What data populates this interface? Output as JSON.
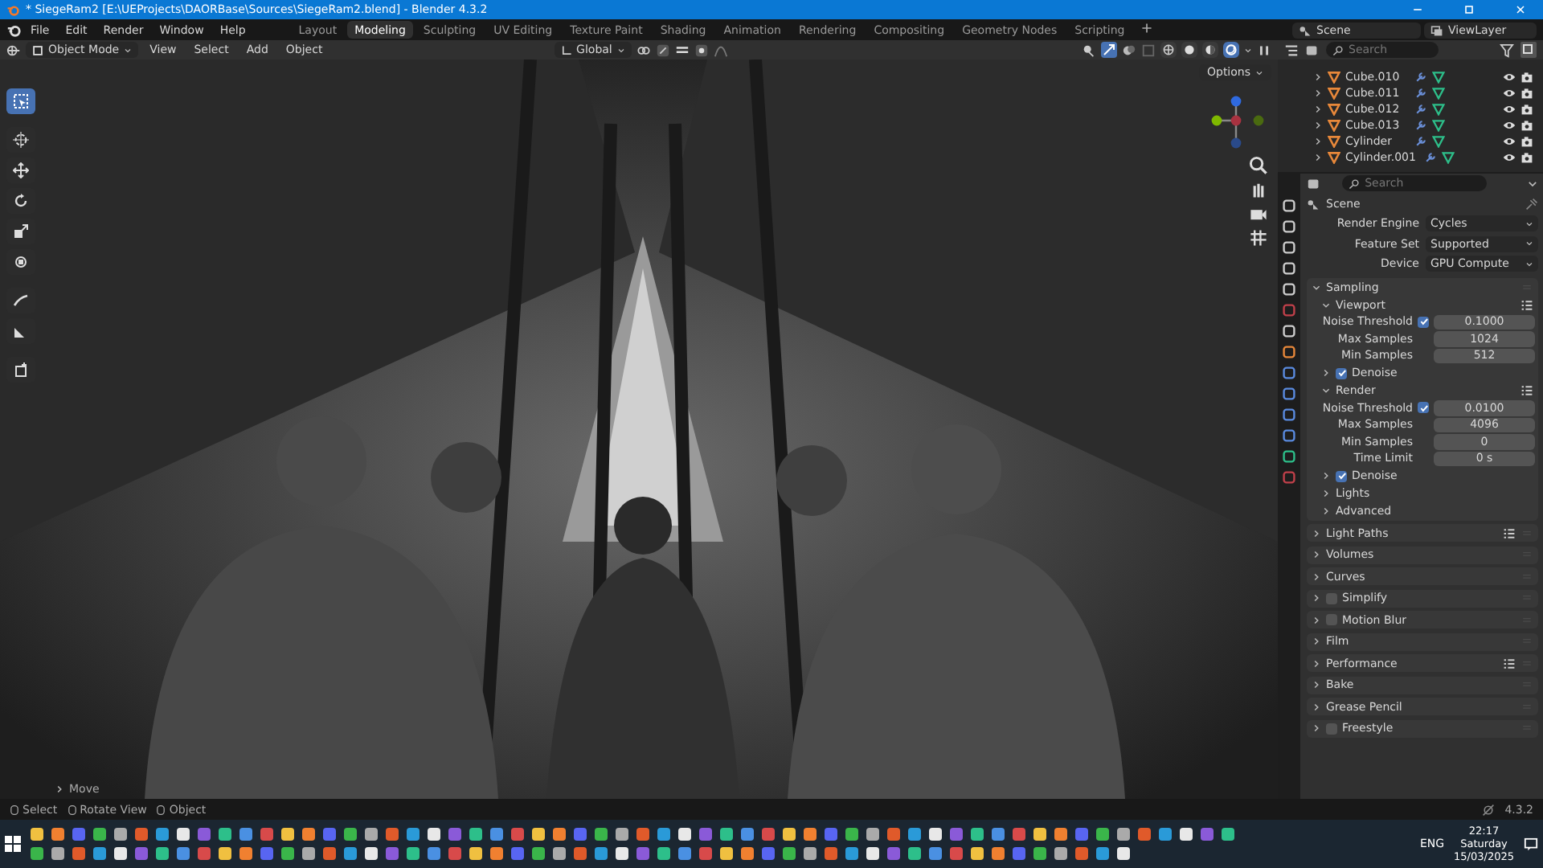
{
  "title_bar": {
    "title": "* SiegeRam2 [E:\\UEProjects\\DAORBase\\Sources\\SiegeRam2.blend] - Blender 4.3.2"
  },
  "menu": [
    "File",
    "Edit",
    "Render",
    "Window",
    "Help"
  ],
  "workspaces": [
    {
      "label": "Layout",
      "selected": false
    },
    {
      "label": "Modeling",
      "selected": true
    },
    {
      "label": "Sculpting",
      "selected": false
    },
    {
      "label": "UV Editing",
      "selected": false
    },
    {
      "label": "Texture Paint",
      "selected": false
    },
    {
      "label": "Shading",
      "selected": false
    },
    {
      "label": "Animation",
      "selected": false
    },
    {
      "label": "Rendering",
      "selected": false
    },
    {
      "label": "Compositing",
      "selected": false
    },
    {
      "label": "Geometry Nodes",
      "selected": false
    },
    {
      "label": "Scripting",
      "selected": false
    }
  ],
  "scene": "Scene",
  "view_layer": "ViewLayer",
  "viewport_header": {
    "mode": "Object Mode",
    "menus": [
      "View",
      "Select",
      "Add",
      "Object"
    ],
    "orientation": "Global",
    "options": "Options",
    "shading": [
      {
        "selected": false
      },
      {
        "selected": false
      },
      {
        "selected": false
      },
      {
        "selected": true
      }
    ]
  },
  "tools": [
    {
      "selected": true
    },
    {
      "selected": false
    },
    {
      "selected": false
    },
    {
      "selected": false
    },
    {
      "selected": false
    },
    {
      "selected": false
    },
    {
      "selected": false
    },
    {
      "selected": false
    },
    {
      "selected": false
    }
  ],
  "last_operator": "Move",
  "outliner": {
    "search_placeholder": "Search",
    "items": [
      "Cube.010",
      "Cube.011",
      "Cube.012",
      "Cube.013",
      "Cylinder",
      "Cylinder.001"
    ]
  },
  "properties": {
    "search_placeholder": "Search",
    "context": "Scene",
    "settings": [
      {
        "label": "Render Engine",
        "value": "Cycles"
      },
      {
        "label": "Feature Set",
        "value": "Supported"
      },
      {
        "label": "Device",
        "value": "GPU Compute"
      }
    ],
    "panels": [
      {
        "title": "Sampling",
        "expanded": true,
        "presets": false,
        "subpanels": [
          {
            "title": "Viewport",
            "expanded": true,
            "presets": true,
            "rows": [
              {
                "kind": "check_number",
                "label": "Noise Threshold",
                "checked": true,
                "value": "0.1000"
              },
              {
                "kind": "number",
                "label": "Max Samples",
                "value": "1024"
              },
              {
                "kind": "number",
                "label": "Min Samples",
                "value": "512"
              }
            ],
            "subpanels": [
              {
                "title": "Denoise",
                "expanded": false,
                "checked": true
              }
            ]
          },
          {
            "title": "Render",
            "expanded": true,
            "presets": true,
            "rows": [
              {
                "kind": "check_number",
                "label": "Noise Threshold",
                "checked": true,
                "value": "0.0100"
              },
              {
                "kind": "number",
                "label": "Max Samples",
                "value": "4096"
              },
              {
                "kind": "number",
                "label": "Min Samples",
                "value": "0"
              },
              {
                "kind": "number",
                "label": "Time Limit",
                "value": "0 s"
              }
            ],
            "subpanels": [
              {
                "title": "Denoise",
                "expanded": false,
                "checked": true
              }
            ]
          },
          {
            "title": "Lights",
            "expanded": false
          },
          {
            "title": "Advanced",
            "expanded": false
          }
        ]
      },
      {
        "title": "Light Paths",
        "expanded": false,
        "presets": true
      },
      {
        "title": "Volumes",
        "expanded": false,
        "presets": false
      },
      {
        "title": "Curves",
        "expanded": false,
        "presets": false
      },
      {
        "title": "Simplify",
        "expanded": false,
        "presets": false,
        "checked": false
      },
      {
        "title": "Motion Blur",
        "expanded": false,
        "presets": false,
        "checked": false
      },
      {
        "title": "Film",
        "expanded": false,
        "presets": false
      },
      {
        "title": "Performance",
        "expanded": false,
        "presets": true
      },
      {
        "title": "Bake",
        "expanded": false,
        "presets": false
      },
      {
        "title": "Grease Pencil",
        "expanded": false,
        "presets": false
      },
      {
        "title": "Freestyle",
        "expanded": false,
        "presets": false,
        "checked": false
      }
    ]
  },
  "status_bar": {
    "hints": [
      "Select",
      "Rotate View",
      "Object"
    ],
    "version": "4.3.2"
  },
  "taskbar": {
    "language": "ENG",
    "time": "22:17",
    "day": "Saturday",
    "date": "15/03/2025"
  }
}
